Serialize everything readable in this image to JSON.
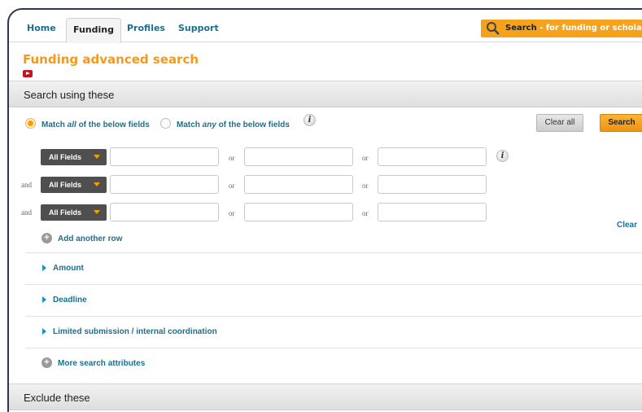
{
  "nav": {
    "tabs": [
      {
        "label": "Home",
        "active": false
      },
      {
        "label": "Funding",
        "active": true
      },
      {
        "label": "Profiles",
        "active": false
      },
      {
        "label": "Support",
        "active": false
      }
    ],
    "search": {
      "label": "Search",
      "hint": " - for funding or scholars",
      "icon": "magnifier-icon"
    }
  },
  "page": {
    "title": "Funding advanced search",
    "video_icon": "video-icon"
  },
  "search_section": {
    "heading": "Search using these",
    "match_all": {
      "prefix": "Match ",
      "emph": "all",
      "suffix": " of the below fields"
    },
    "match_any": {
      "prefix": "Match ",
      "emph": "any",
      "suffix": " of the below fields"
    },
    "clear_all": "Clear all",
    "search": "Search",
    "rows": [
      {
        "conj": "",
        "field": "All Fields",
        "or1": "or",
        "or2": "or"
      },
      {
        "conj": "and",
        "field": "All Fields",
        "or1": "or",
        "or2": "or"
      },
      {
        "conj": "and",
        "field": "All Fields",
        "or1": "or",
        "or2": "or"
      }
    ],
    "clear": "Clear",
    "add_row": "Add another row",
    "expanders": [
      "Amount",
      "Deadline",
      "Limited submission / internal coordination"
    ],
    "more_attributes": "More search attributes"
  },
  "exclude_section": {
    "heading": "Exclude these"
  },
  "colors": {
    "accent": "#f39a1c",
    "link": "#1a6f8e",
    "search_button": "#f6a21b"
  }
}
